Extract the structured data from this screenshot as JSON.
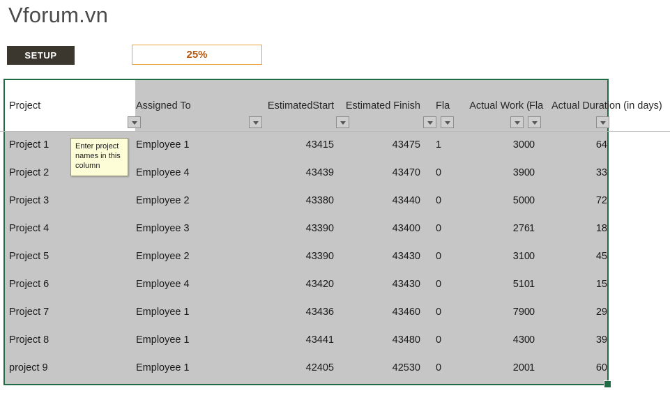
{
  "brand": {
    "title": "Vforum.vn"
  },
  "toolbar": {
    "setup_label": "SETUP",
    "progress_value": "25%",
    "accent_orange": "#e8a33b",
    "progress_text_color": "#b4590f",
    "setup_bg": "#3b362e"
  },
  "table": {
    "selection_border_color": "#1e6b46",
    "header_bg": "#c6c6c6",
    "first_header_cell_bg": "#ffffff",
    "columns": [
      {
        "label": "Project",
        "align": "left",
        "filter": true
      },
      {
        "label": "Assigned To",
        "align": "left",
        "filter": true
      },
      {
        "label": "EstimatedStart",
        "align": "right",
        "filter": true
      },
      {
        "label": "Estimated Finish",
        "align": "right",
        "filter": true
      },
      {
        "label": "Fla",
        "align": "left",
        "filter": true
      },
      {
        "label": "Actual Work (",
        "align": "right",
        "filter": true
      },
      {
        "label": "Fla",
        "align": "left",
        "filter": true
      },
      {
        "label": "Actual Duration (in days)",
        "align": "right",
        "filter": true
      }
    ],
    "rows": [
      {
        "project": "Project 1",
        "assigned": "Employee 1",
        "est_start": "43415",
        "est_finish": "43475",
        "flag1": "1",
        "actual_work": "300",
        "flag2": "0",
        "actual_duration": "64"
      },
      {
        "project": "Project 2",
        "assigned": "Employee 4",
        "est_start": "43439",
        "est_finish": "43470",
        "flag1": "0",
        "actual_work": "390",
        "flag2": "0",
        "actual_duration": "33"
      },
      {
        "project": "Project 3",
        "assigned": "Employee 2",
        "est_start": "43380",
        "est_finish": "43440",
        "flag1": "0",
        "actual_work": "500",
        "flag2": "0",
        "actual_duration": "72"
      },
      {
        "project": "Project 4",
        "assigned": "Employee 3",
        "est_start": "43390",
        "est_finish": "43400",
        "flag1": "0",
        "actual_work": "276",
        "flag2": "1",
        "actual_duration": "18"
      },
      {
        "project": "Project 5",
        "assigned": "Employee 2",
        "est_start": "43390",
        "est_finish": "43430",
        "flag1": "0",
        "actual_work": "310",
        "flag2": "0",
        "actual_duration": "45"
      },
      {
        "project": "Project 6",
        "assigned": "Employee 4",
        "est_start": "43420",
        "est_finish": "43430",
        "flag1": "0",
        "actual_work": "510",
        "flag2": "1",
        "actual_duration": "15"
      },
      {
        "project": "Project 7",
        "assigned": "Employee 1",
        "est_start": "43436",
        "est_finish": "43460",
        "flag1": "0",
        "actual_work": "790",
        "flag2": "0",
        "actual_duration": "29"
      },
      {
        "project": "Project 8",
        "assigned": "Employee 1",
        "est_start": "43441",
        "est_finish": "43480",
        "flag1": "0",
        "actual_work": "430",
        "flag2": "0",
        "actual_duration": "39"
      },
      {
        "project": "project 9",
        "assigned": "Employee 1",
        "est_start": "42405",
        "est_finish": "42530",
        "flag1": "0",
        "actual_work": "200",
        "flag2": "1",
        "actual_duration": "60"
      }
    ]
  },
  "comment": {
    "text": "Enter project names in this column"
  }
}
